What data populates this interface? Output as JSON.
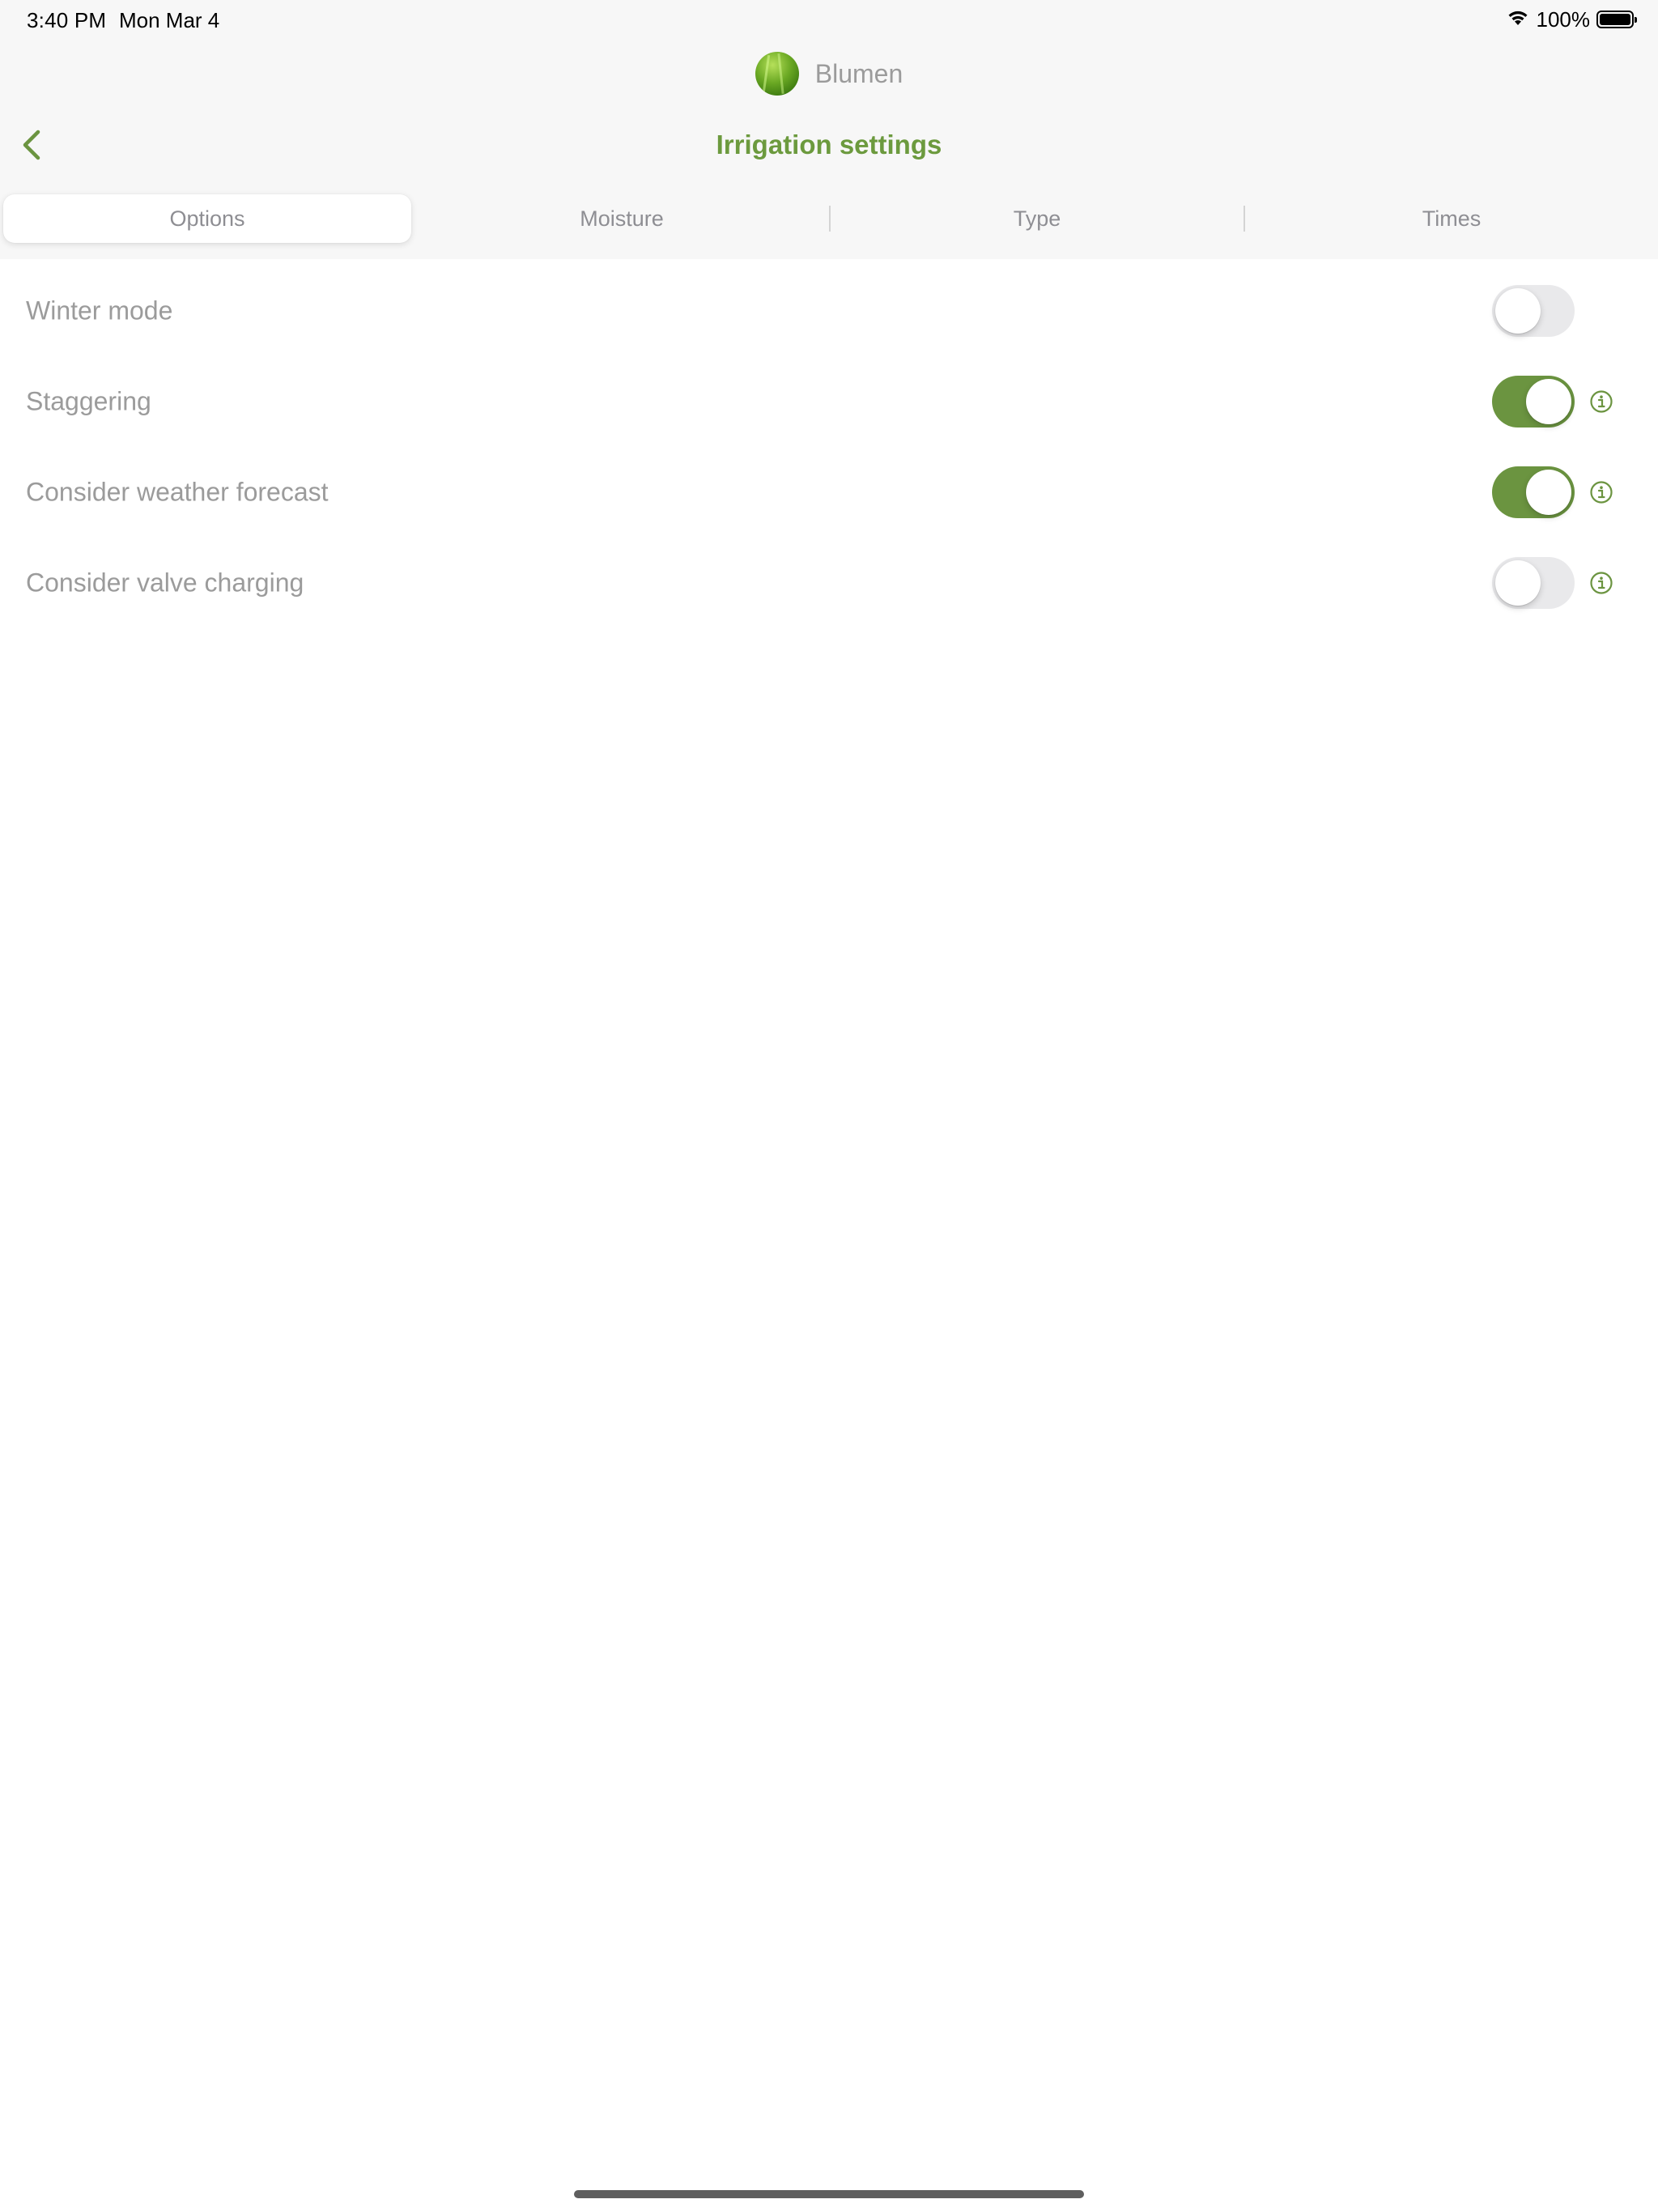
{
  "status_bar": {
    "time": "3:40 PM",
    "date": "Mon Mar 4",
    "battery_text": "100%",
    "battery_level": 1.0
  },
  "device": {
    "name": "Blumen"
  },
  "nav": {
    "title": "Irrigation settings"
  },
  "tabs": [
    {
      "label": "Options",
      "selected": true
    },
    {
      "label": "Moisture",
      "selected": false
    },
    {
      "label": "Type",
      "selected": false
    },
    {
      "label": "Times",
      "selected": false
    }
  ],
  "settings": [
    {
      "label": "Winter mode",
      "enabled": false,
      "has_info": false
    },
    {
      "label": "Staggering",
      "enabled": true,
      "has_info": true
    },
    {
      "label": "Consider weather forecast",
      "enabled": true,
      "has_info": true
    },
    {
      "label": "Consider valve charging",
      "enabled": false,
      "has_info": true
    }
  ],
  "colors": {
    "accent": "#6b9440",
    "title": "#6c9a3e",
    "header_bg": "#f7f7f7",
    "toggle_off": "#e9e9eb"
  },
  "icons": {
    "back": "chevron-left-icon",
    "info": "info-circle-icon",
    "wifi": "wifi-icon",
    "battery": "battery-icon"
  }
}
